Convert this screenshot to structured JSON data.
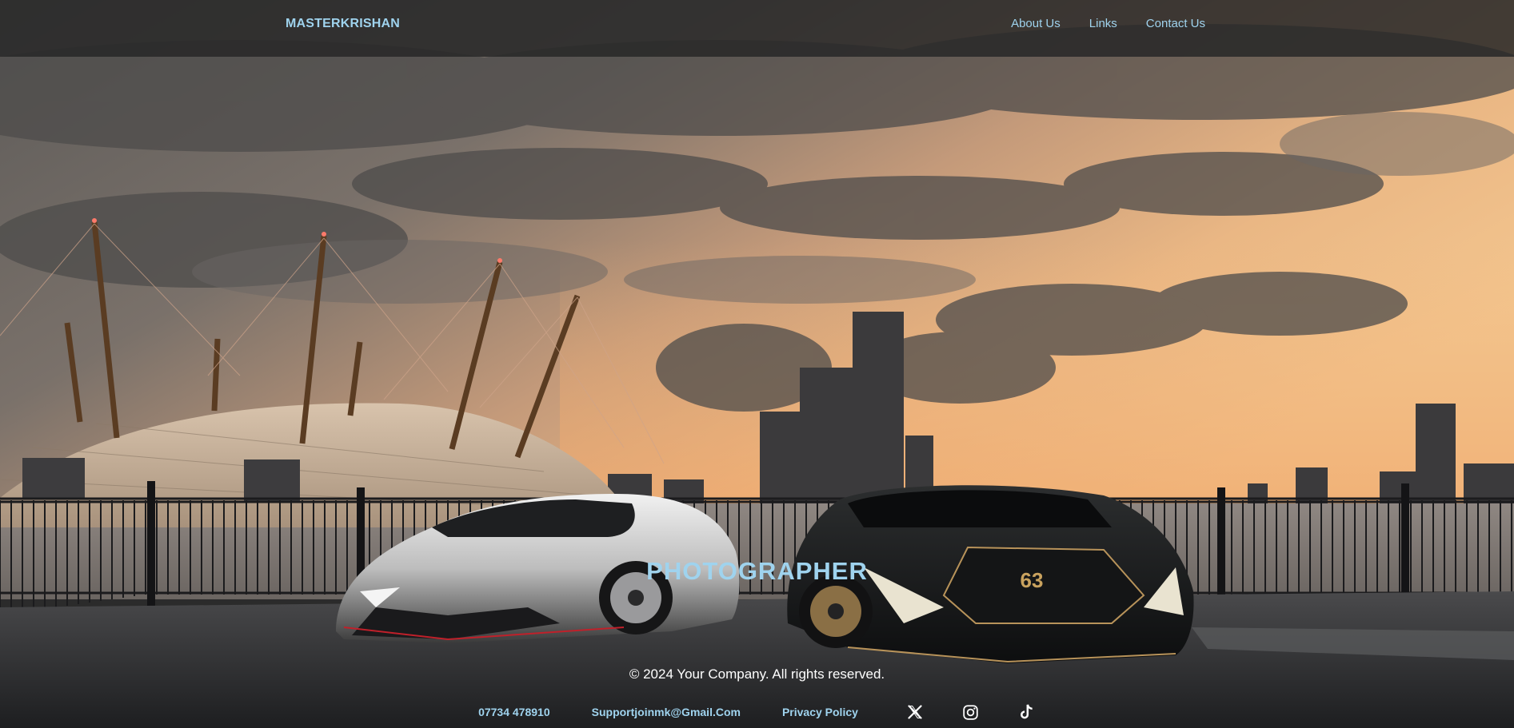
{
  "header": {
    "brand": "MASTERKRISHAN",
    "nav": [
      {
        "label": "About Us"
      },
      {
        "label": "Links"
      },
      {
        "label": "Contact Us"
      }
    ]
  },
  "hero": {
    "title": "PHOTOGRAPHER",
    "background_image": "sunset skyline with dome, cranes and two supercars"
  },
  "footer": {
    "copyright": "© 2024 Your Company. All rights reserved.",
    "phone": "07734 478910",
    "email": "Supportjoinmk@Gmail.Com",
    "privacy": "Privacy Policy",
    "social": [
      "x-icon",
      "instagram-icon",
      "tiktok-icon"
    ]
  },
  "colors": {
    "accent": "#9fd3ee",
    "header_bg": "#282828",
    "text": "#ffffff"
  }
}
